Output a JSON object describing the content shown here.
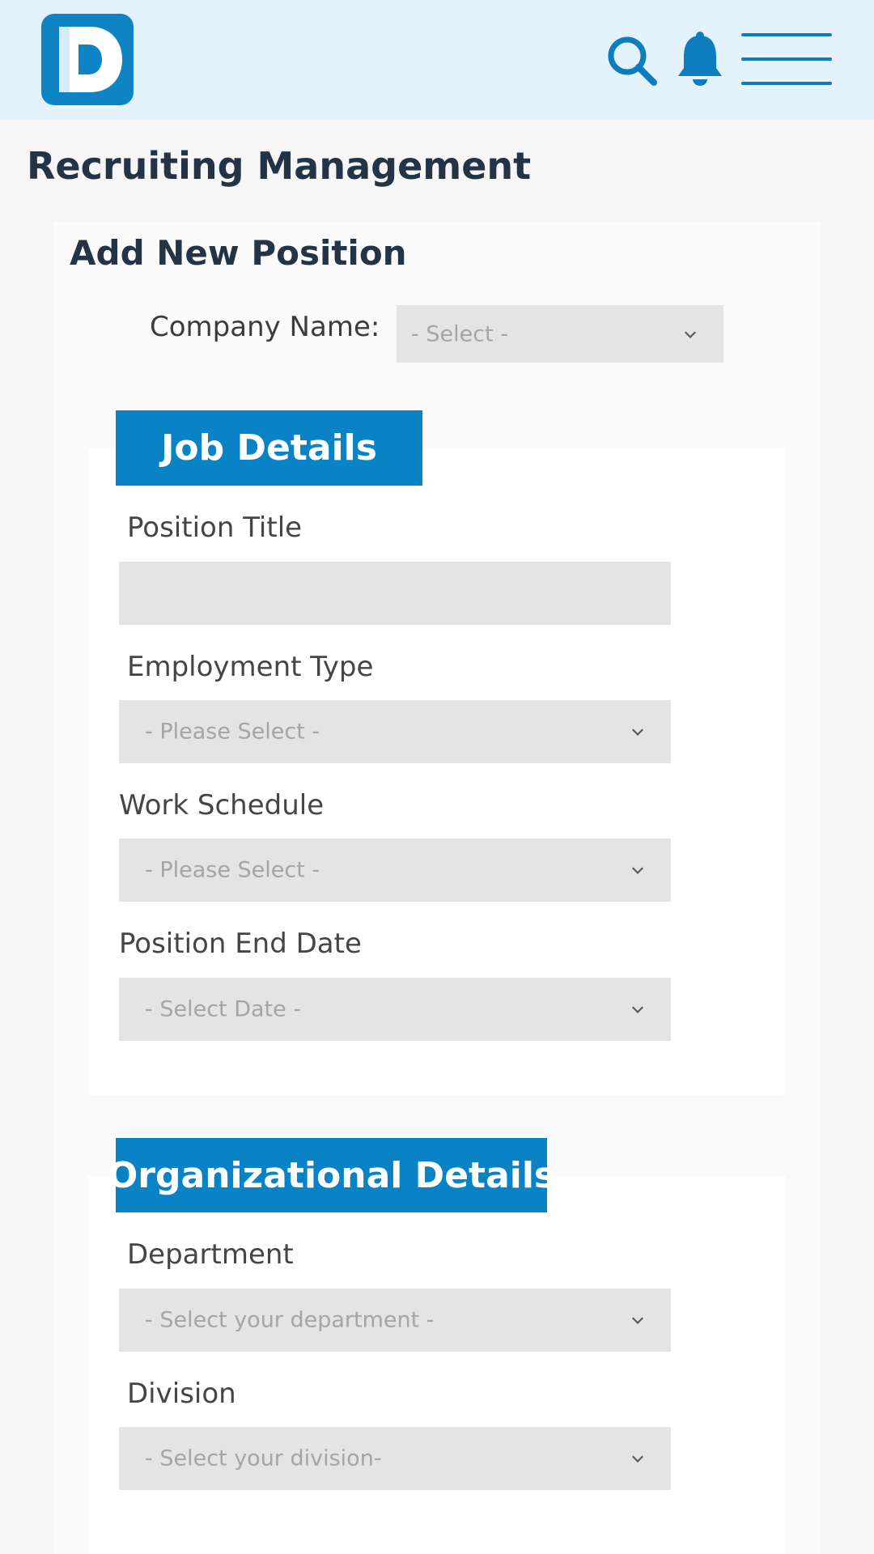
{
  "header": {
    "logo_letter": "D",
    "icons": [
      "search-icon",
      "bell-icon",
      "hamburger-menu-icon"
    ]
  },
  "colors": {
    "topbar_bg": "#e4f3fb",
    "accent": "#0983c6",
    "title_text": "#243447",
    "field_bg": "#e4e4e4",
    "placeholder_text": "#a5a5a5"
  },
  "page": {
    "title": "Recruiting Management"
  },
  "form": {
    "title": "Add New Position",
    "company": {
      "label": "Company Name:",
      "placeholder": "- Select -"
    },
    "job_details": {
      "header": "Job Details",
      "position_title": {
        "label": "Position Title",
        "value": ""
      },
      "employment_type": {
        "label": "Employment Type",
        "placeholder": "- Please Select -"
      },
      "work_schedule": {
        "label": "Work Schedule",
        "placeholder": "- Please Select -"
      },
      "position_end_date": {
        "label": "Position End Date",
        "placeholder": "- Select Date -"
      }
    },
    "organizational_details": {
      "header": "Organizational Details",
      "department": {
        "label": "Department",
        "placeholder": "- Select your department -"
      },
      "division": {
        "label": "Division",
        "placeholder": "- Select your division-"
      }
    }
  }
}
